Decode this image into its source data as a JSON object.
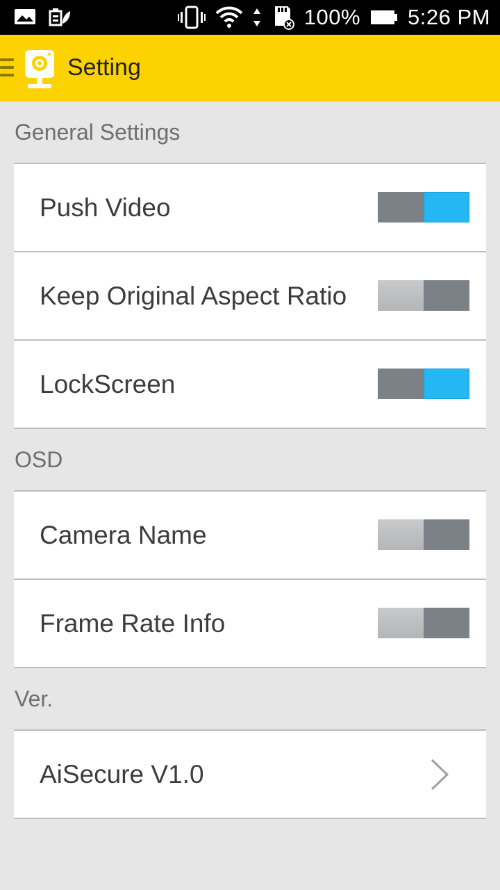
{
  "status_bar": {
    "battery_percent": "100%",
    "time": "5:26 PM"
  },
  "app_bar": {
    "title": "Setting",
    "menu_icon": "hamburger-icon",
    "logo_icon": "camera-logo-icon",
    "background_color": "#fcd200"
  },
  "sections": {
    "general": {
      "title": "General Settings",
      "items": [
        {
          "label": "Push Video",
          "enabled": true
        },
        {
          "label": "Keep Original Aspect Ratio",
          "enabled": false
        },
        {
          "label": "LockScreen",
          "enabled": true
        }
      ]
    },
    "osd": {
      "title": "OSD",
      "items": [
        {
          "label": "Camera Name",
          "enabled": false
        },
        {
          "label": "Frame Rate Info",
          "enabled": false
        }
      ]
    },
    "ver": {
      "title": "Ver.",
      "items": [
        {
          "label": "AiSecure V1.0",
          "icon": "chevron-right-icon"
        }
      ]
    }
  },
  "colors": {
    "toggle_on": "#25b7f3",
    "toggle_off": "#7c8187"
  }
}
